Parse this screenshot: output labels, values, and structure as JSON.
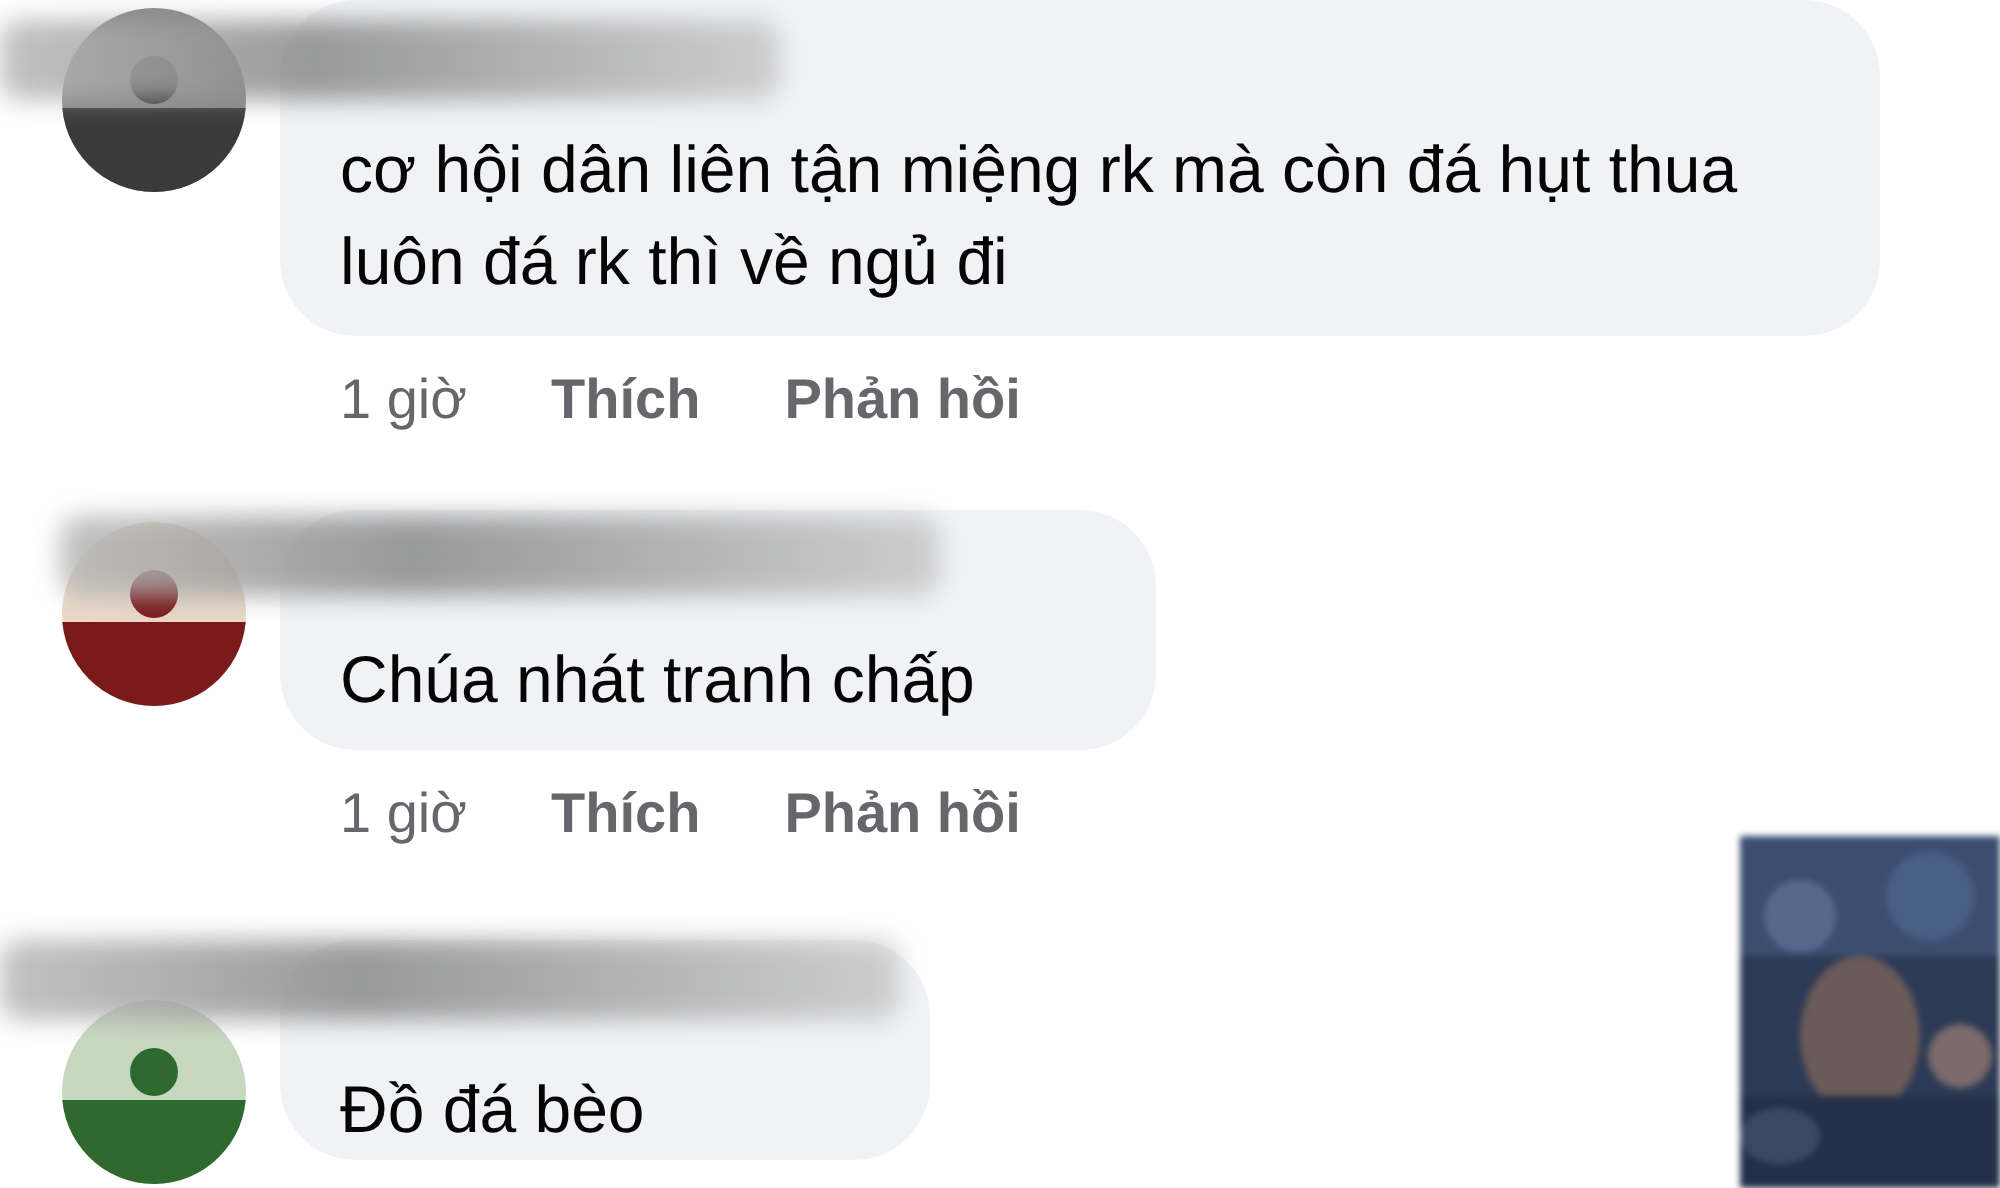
{
  "comments": [
    {
      "text": "cơ hội dân liên tận miệng rk mà còn đá hụt thua luôn đá rk thì về ngủ đi",
      "time": "1 giờ",
      "like": "Thích",
      "reply": "Phản hồi"
    },
    {
      "text": "Chúa nhát tranh chấp",
      "time": "1 giờ",
      "like": "Thích",
      "reply": "Phản hồi"
    },
    {
      "text": "Đồ đá bèo"
    }
  ]
}
